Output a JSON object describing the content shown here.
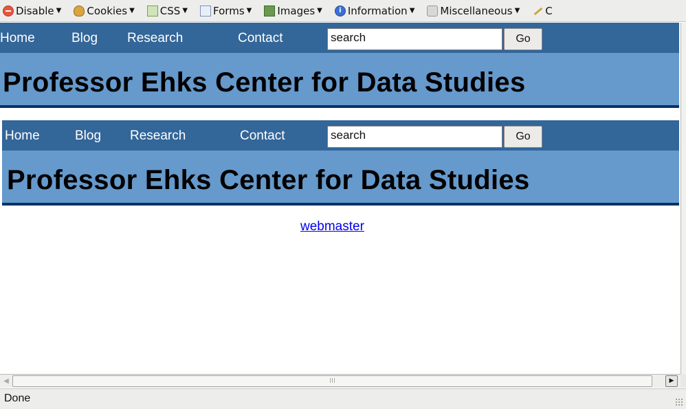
{
  "toolbar": {
    "menus": [
      {
        "label": "Disable",
        "icon": "disable-icon"
      },
      {
        "label": "Cookies",
        "icon": "cookies-icon"
      },
      {
        "label": "CSS",
        "icon": "css-icon"
      },
      {
        "label": "Forms",
        "icon": "forms-icon"
      },
      {
        "label": "Images",
        "icon": "images-icon"
      },
      {
        "label": "Information",
        "icon": "information-icon"
      },
      {
        "label": "Miscellaneous",
        "icon": "miscellaneous-icon"
      },
      {
        "label": "C",
        "icon": "outline-icon"
      }
    ],
    "dropdown_glyph": "▼"
  },
  "sites": [
    {
      "nav": {
        "home": "Home",
        "blog": "Blog",
        "research": "Research",
        "contact": "Contact"
      },
      "search": {
        "value": "search",
        "button": "Go"
      },
      "title": "Professor Ehks Center for Data Studies"
    },
    {
      "nav": {
        "home": "Home",
        "blog": "Blog",
        "research": "Research",
        "contact": "Contact"
      },
      "search": {
        "value": "search",
        "button": "Go"
      },
      "title": "Professor Ehks Center for Data Studies"
    }
  ],
  "footer": {
    "link": "webmaster"
  },
  "statusbar": {
    "text": "Done"
  },
  "scrollbar": {
    "grip": "III",
    "left_arrow": "◀",
    "right_arrow": "▶"
  },
  "colors": {
    "nav_bg": "#336699",
    "banner_bg": "#6699cc",
    "banner_border": "#003366",
    "link": "#0000ee"
  }
}
